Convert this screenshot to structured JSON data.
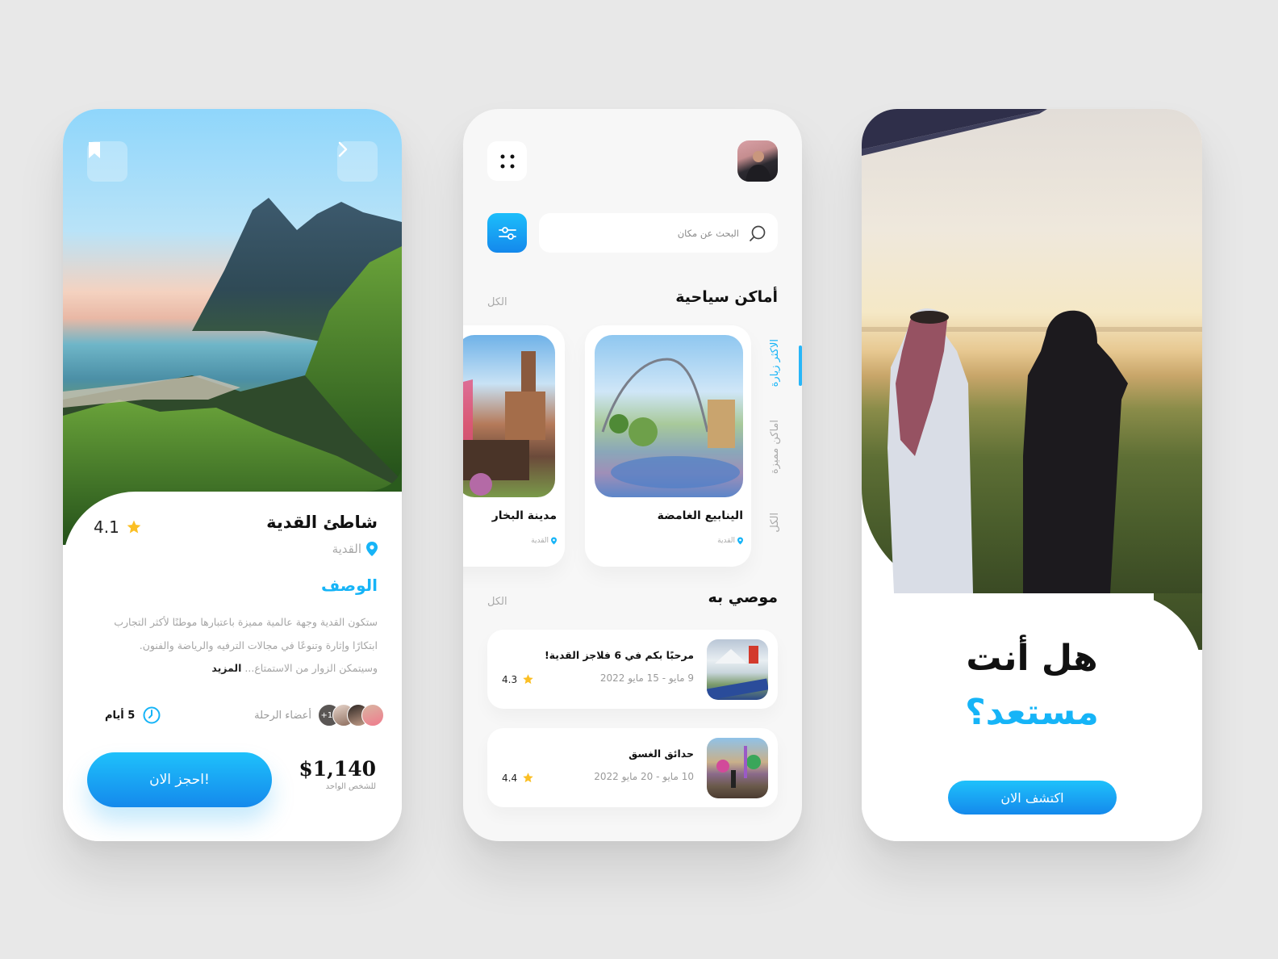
{
  "colors": {
    "accent": "#16b4f7",
    "accent_dark": "#1489ec",
    "star": "#fbbf24",
    "background": "#e8e8e8"
  },
  "detail": {
    "bookmark_icon": "bookmark-icon",
    "next_icon": "chevron-right-icon",
    "title": "شاطئ القدية",
    "rating": "4.1",
    "location": "القدية",
    "description_title": "الوصف",
    "description": "ستكون القدية وجهة عالمية مميزة باعتبارها موطنًا لأكثر التجارب ابتكارًا وإثارة وتنوعًا في مجالات الترفيه والرياضة والفنون. وسيتمكن الزوار من الاستمتاع...",
    "more_label": "المزيد",
    "members_label": "أعضاء الرحلة",
    "members_extra": "+14",
    "duration": "5 أيام",
    "price": "$1,140",
    "price_note": "للشخص الواحد",
    "book_label": "احجز الان!"
  },
  "home": {
    "search_placeholder": "البحث عن مكان",
    "tourist_title": "أماكن سياحية",
    "tourist_all": "الكل",
    "tabs": [
      {
        "label": "الاكثر زيارة",
        "active": true
      },
      {
        "label": "اماكن مميزة",
        "active": false
      },
      {
        "label": "الكل",
        "active": false
      }
    ],
    "places": [
      {
        "name": "الينابيع الغامضة",
        "location": "القدية"
      },
      {
        "name": "مدينة البخار",
        "location": "القدية"
      }
    ],
    "recommended_title": "موصي به",
    "recommended_all": "الكل",
    "recommended": [
      {
        "title": "مرحبًا بكم في 6 فلاجز القدية!",
        "dates": "9 مايو - 15 مايو 2022",
        "rating": "4.3"
      },
      {
        "title": "حدائق الغسق",
        "dates": "10 مايو - 20 مايو 2022",
        "rating": "4.4"
      }
    ]
  },
  "onboarding": {
    "line1": "هل أنت",
    "line2": "مستعد؟",
    "cta_label": "اكتشف الان"
  }
}
